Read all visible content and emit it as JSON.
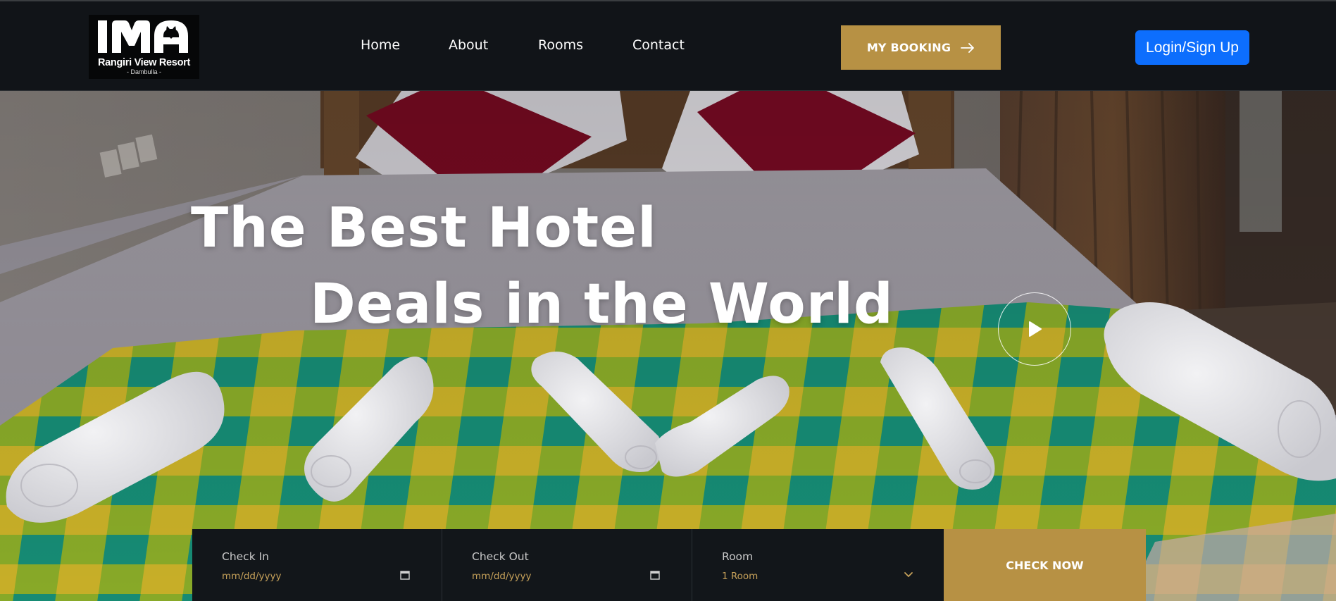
{
  "brand": {
    "logo_letters": "IMA",
    "name": "Rangiri View Resort",
    "location": "- Dambulla -"
  },
  "nav": {
    "items": [
      {
        "label": "Home"
      },
      {
        "label": "About"
      },
      {
        "label": "Rooms"
      },
      {
        "label": "Contact"
      }
    ],
    "booking_label": "MY BOOKING",
    "login_label": "Login/Sign Up"
  },
  "hero": {
    "title_line1": "The Best Hotel",
    "title_line2": "Deals in the World"
  },
  "booking_form": {
    "check_in": {
      "label": "Check In",
      "value": "mm/dd/yyyy"
    },
    "check_out": {
      "label": "Check Out",
      "value": "mm/dd/yyyy"
    },
    "room": {
      "label": "Room",
      "value": "1 Room"
    },
    "submit_label": "CHECK NOW"
  },
  "icons": {
    "booking": "arrow-right-icon",
    "play": "play-icon",
    "date": "calendar-icon",
    "select": "chevron-down-icon"
  },
  "colors": {
    "accent_gold": "#b79144",
    "login_blue": "#0d6efd",
    "dark": "#111418",
    "field_value": "#c6a15a"
  }
}
